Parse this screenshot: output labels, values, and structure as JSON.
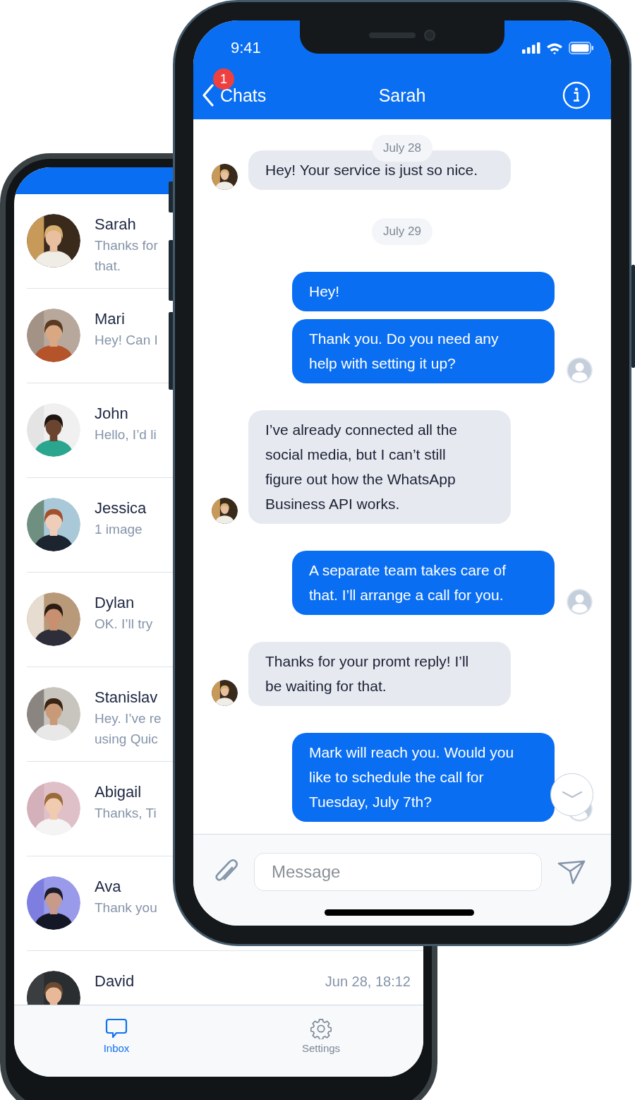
{
  "back_phone": {
    "chat_list": [
      {
        "name": "Sarah",
        "preview_lines": [
          "Thanks for",
          "that."
        ]
      },
      {
        "name": "Mari",
        "preview_lines": [
          "Hey! Can I"
        ]
      },
      {
        "name": "John",
        "preview_lines": [
          "Hello, I’d li"
        ]
      },
      {
        "name": "Jessica",
        "preview_lines": [
          "1 image"
        ]
      },
      {
        "name": "Dylan",
        "preview_lines": [
          "OK. I’ll try"
        ]
      },
      {
        "name": "Stanislav",
        "preview_lines": [
          "Hey. I’ve re",
          "using Quic"
        ]
      },
      {
        "name": "Abigail",
        "preview_lines": [
          "Thanks, Ti"
        ]
      },
      {
        "name": "Ava",
        "preview_lines": [
          "Thank you"
        ]
      },
      {
        "name": "David",
        "time": "Jun 28, 18:12"
      }
    ],
    "tab_bar": [
      {
        "label": "Inbox",
        "selected": true
      },
      {
        "label": "Settings",
        "selected": false
      }
    ]
  },
  "front_phone": {
    "status_bar": {
      "time": "9:41"
    },
    "nav": {
      "back_label": "Chats",
      "badge": "1",
      "title": "Sarah"
    },
    "messages": [
      {
        "kind": "date",
        "text": "July 28"
      },
      {
        "kind": "incoming",
        "text": "Hey! Your service is just so nice."
      },
      {
        "kind": "date",
        "text": "July 29"
      },
      {
        "kind": "outgoing",
        "text": "Hey!"
      },
      {
        "kind": "outgoing",
        "text": "Thank you. Do you need any help with setting it up?"
      },
      {
        "kind": "incoming",
        "text": "I’ve already connected all the social media, but I can’t still figure out how the WhatsApp Business API works."
      },
      {
        "kind": "outgoing",
        "text": "A separate team takes care of that. I’ll arrange a call for you."
      },
      {
        "kind": "incoming",
        "text": "Thanks for your promt reply! I’ll be waiting for that."
      },
      {
        "kind": "outgoing",
        "text": "Mark will reach you. Would you like to schedule the call for Tuesday, July 7th?"
      }
    ],
    "composer": {
      "placeholder": "Message"
    }
  }
}
